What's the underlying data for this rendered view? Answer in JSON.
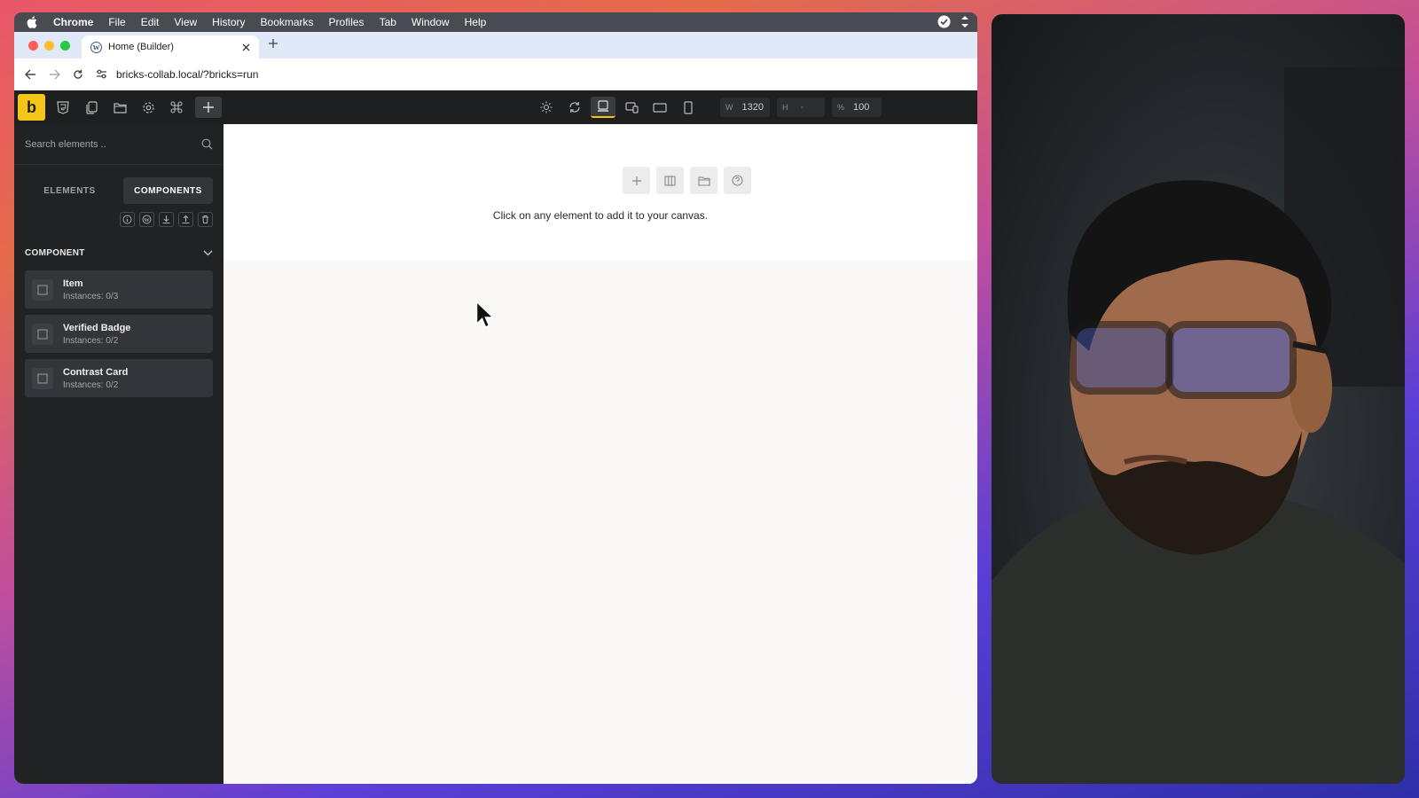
{
  "menubar": {
    "app": "Chrome",
    "items": [
      "File",
      "Edit",
      "View",
      "History",
      "Bookmarks",
      "Profiles",
      "Tab",
      "Window",
      "Help"
    ]
  },
  "browser": {
    "tab_title": "Home (Builder)",
    "url": "bricks-collab.local/?bricks=run"
  },
  "toolbar": {
    "logo": "b",
    "width_label": "W",
    "width_value": "1320",
    "height_label": "H",
    "height_value": "-",
    "zoom_label": "%",
    "zoom_value": "100"
  },
  "sidebar": {
    "search_placeholder": "Search elements ..",
    "tab_elements": "ELEMENTS",
    "tab_components": "COMPONENTS",
    "section_title": "COMPONENT",
    "components": [
      {
        "name": "Item",
        "instances": "Instances: 0/3"
      },
      {
        "name": "Verified Badge",
        "instances": "Instances: 0/2"
      },
      {
        "name": "Contrast Card",
        "instances": "Instances: 0/2"
      }
    ]
  },
  "canvas": {
    "hint": "Click on any element to add it to your canvas."
  },
  "colors": {
    "accent": "#f5c518",
    "toolbar_bg": "#1e1f21",
    "sidebar_bg": "#212224"
  }
}
